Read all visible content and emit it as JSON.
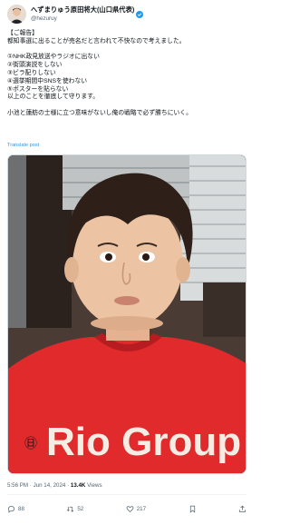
{
  "author": {
    "display_name": "へずまりゅう原田将大(山口県代表)",
    "handle": "@hezuruy"
  },
  "tweet": {
    "lines": [
      "【ご報告】",
      "都知事選に出ることが売名だと言われて不快なので考えました。",
      "",
      "①NHK政見放送やラジオに出ない",
      "②街頭演説をしない",
      "③ビラ配りしない",
      "④選挙期間中SNSを使わない",
      "⑤ポスターを貼らない",
      "以上のことを徹底して守ります。",
      "",
      "小池と蓮舫の士様に立つ意味がないし俺の戦略で必ず勝ちにいく。"
    ]
  },
  "translate_label": "Translate post",
  "media": {
    "shirt_text": "Rio Group"
  },
  "meta": {
    "time": "5:56 PM",
    "date": "Jun 14, 2024",
    "views": "13.4K",
    "views_label": "Views",
    "separator": "·"
  },
  "actions": {
    "replies": "88",
    "reposts": "52",
    "likes": "217"
  },
  "colors": {
    "accent": "#1d9bf0",
    "text": "#0f1419",
    "muted": "#536471",
    "shirt_red": "#e02a2c"
  }
}
